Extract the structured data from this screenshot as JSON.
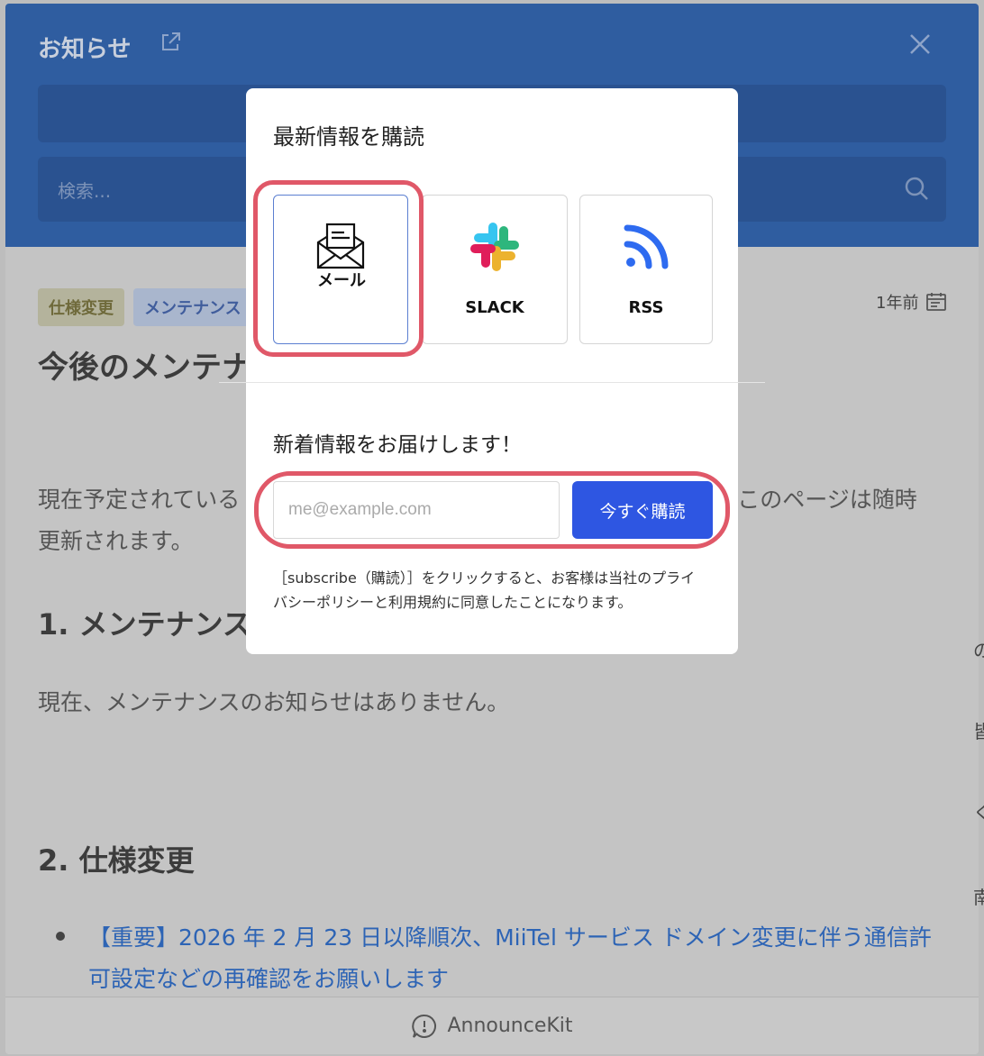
{
  "header": {
    "title": "お知らせ",
    "search_placeholder": "検索..."
  },
  "article": {
    "badges": [
      "仕様変更",
      "メンテナンス"
    ],
    "date": "1年前",
    "title": "今後のメンテナ",
    "para1_start": "現在予定されている",
    "para1_end": "このページは随時",
    "para1_line2": "更新されます。",
    "heading_maintenance": "1. メンテナンス",
    "para2": "現在、メンテナンスのお知らせはありません。",
    "heading_spec": "2. 仕様変更",
    "bullet_link": "【重要】2026 年 2 月 23 日以降順次、MiiTel サービス ドメイン変更に伴う通信許可設定などの再確認をお願いします"
  },
  "footer": {
    "brand": "AnnounceKit"
  },
  "edge_fragments": [
    "の",
    "皆",
    "く",
    "南"
  ],
  "modal": {
    "title": "最新情報を購読",
    "options": [
      {
        "label": "メール",
        "icon": "envelope-icon"
      },
      {
        "label": "SLACK",
        "icon": "slack-icon"
      },
      {
        "label": "RSS",
        "icon": "rss-icon"
      }
    ],
    "subtitle": "新着情報をお届けします！",
    "email_placeholder": "me@example.com",
    "subscribe_label": "今すぐ購読",
    "disclaimer": "［subscribe（購読）］をクリックすると、お客様は当社のプライバシーポリシーと利用規約に同意したことになります。"
  },
  "colors": {
    "header_bg": "#2f5da0",
    "subscribe_button": "#2e56e2",
    "highlight_ring": "#e05868"
  }
}
